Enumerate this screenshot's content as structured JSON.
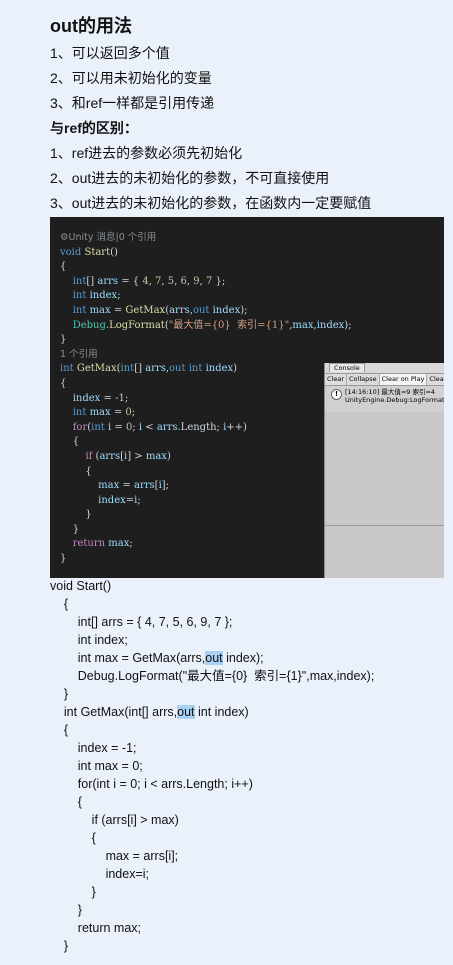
{
  "heading": "out的用法",
  "points": [
    "1、可以返回多个值",
    "2、可以用未初始化的变量",
    "3、和ref一样都是引用传递"
  ],
  "subheading": "与ref的区别：",
  "differences": [
    "1、ref进去的参数必须先初始化",
    "2、out进去的未初始化的参数，不可直接使用",
    "3、out进去的未初始化的参数，在函数内一定要赋值"
  ],
  "editor": {
    "hint_unity": "⚙Unity 消息|0 个引用",
    "hint_refs": "1 个引用"
  },
  "console": {
    "tab": "Console",
    "buttons": [
      "Clear",
      "Collapse",
      "Clear on Play",
      "Clear o"
    ],
    "log_line1": "[14:16:10] 最大值=9  索引=4",
    "log_line2": "UnityEngine.Debug:LogFormat(St"
  },
  "code_lines": [
    "void Start()",
    "    {",
    "        int[] arrs = { 4, 7, 5, 6, 9, 7 };",
    "        int index;",
    "        int max = GetMax(arrs,out index);",
    "        Debug.LogFormat(\"最大值={0}  索引={1}\",max,index);",
    "    }",
    "    int GetMax(int[] arrs,out int index)",
    "    {",
    "        index = -1;",
    "        int max = 0;",
    "        for(int i = 0; i < arrs.Length; i++)",
    "        {",
    "            if (arrs[i] > max)",
    "            {",
    "                max = arrs[i];",
    "                index=i;",
    "            }",
    "        }",
    "        return max;",
    "    }"
  ]
}
